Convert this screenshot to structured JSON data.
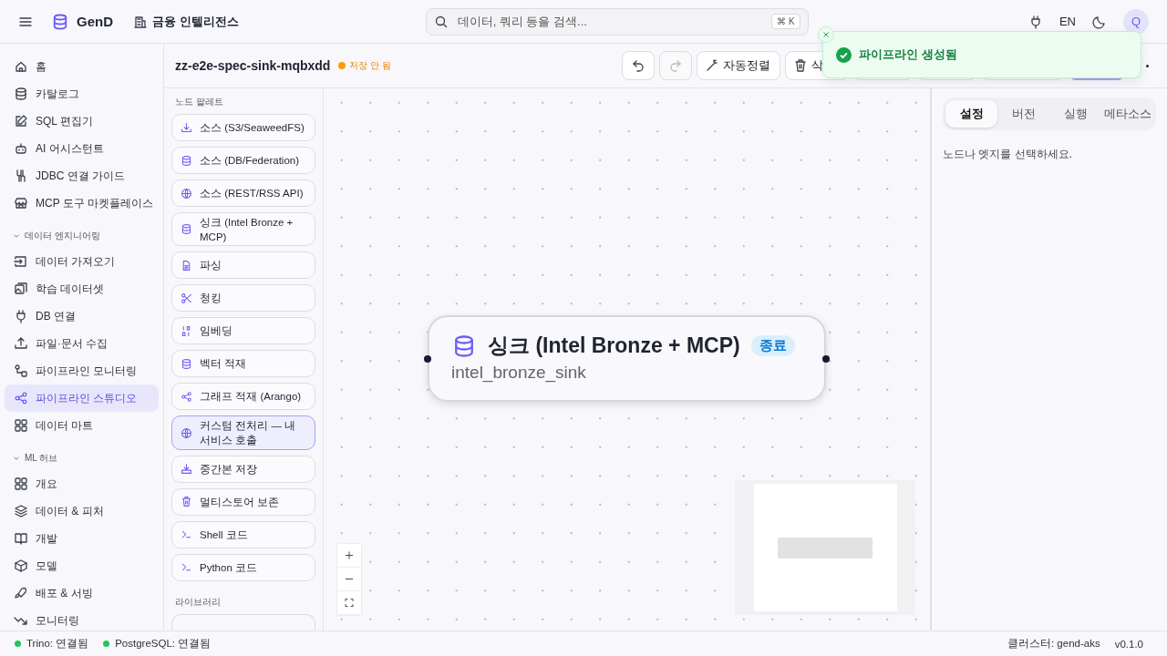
{
  "topbar": {
    "app_name": "GenD",
    "workspace": "금융 인텔리전스",
    "search": {
      "placeholder": "데이터, 쿼리 등을 검색...",
      "shortcut": "⌘ K"
    },
    "language": "EN",
    "avatar": "Q"
  },
  "sidebar": {
    "groups": [
      {
        "items": [
          {
            "label": "홈",
            "selected": false
          },
          {
            "label": "카탈로그",
            "selected": false
          },
          {
            "label": "SQL 편집기",
            "selected": false
          },
          {
            "label": "AI 어시스턴트",
            "selected": false
          },
          {
            "label": "JDBC 연결 가이드",
            "selected": false
          },
          {
            "label": "MCP 도구 마켓플레이스",
            "selected": false
          }
        ]
      },
      {
        "heading": "데이터 엔지니어링",
        "expanded": true,
        "items": [
          {
            "label": "데이터 가져오기",
            "selected": false
          },
          {
            "label": "학습 데이터셋",
            "selected": false
          },
          {
            "label": "DB 연결",
            "selected": false
          },
          {
            "label": "파일·문서 수집",
            "selected": false
          },
          {
            "label": "파이프라인 모니터링",
            "selected": false
          },
          {
            "label": "파이프라인 스튜디오",
            "selected": true
          },
          {
            "label": "데이터 마트",
            "selected": false
          }
        ]
      },
      {
        "heading": "ML 허브",
        "expanded": true,
        "items": [
          {
            "label": "개요",
            "selected": false
          },
          {
            "label": "데이터 & 피처",
            "selected": false
          },
          {
            "label": "개발",
            "selected": false
          },
          {
            "label": "모델",
            "selected": false
          },
          {
            "label": "배포 & 서빙",
            "selected": false
          },
          {
            "label": "모니터링",
            "selected": false
          }
        ]
      }
    ]
  },
  "editor": {
    "pipeline_name": "zz-e2e-spec-sink-mqbxdd",
    "save_status": "저장 안 됨",
    "toolbar": [
      {
        "kind": "undo",
        "disabled": false
      },
      {
        "kind": "redo",
        "disabled": true
      },
      {
        "kind": "text",
        "label": "자동정렬"
      },
      {
        "kind": "text",
        "label": "삭"
      },
      {
        "kind": "blank"
      },
      {
        "kind": "blank"
      },
      {
        "kind": "blank"
      },
      {
        "kind": "primary"
      }
    ]
  },
  "palette": {
    "title": "노드 팔레트",
    "items": [
      {
        "label": "소스 (S3/SeaweedFS)",
        "selected": false
      },
      {
        "label": "소스 (DB/Federation)",
        "selected": false
      },
      {
        "label": "소스 (REST/RSS API)",
        "selected": false
      },
      {
        "label": "싱크 (Intel Bronze + MCP)",
        "selected": false
      },
      {
        "label": "파싱",
        "selected": false
      },
      {
        "label": "청킹",
        "selected": false
      },
      {
        "label": "임베딩",
        "selected": false
      },
      {
        "label": "벡터 적재",
        "selected": false
      },
      {
        "label": "그래프 적재 (Arango)",
        "selected": false
      },
      {
        "label": "커스텀 전처리 — 내 서비스 호출",
        "selected": true
      },
      {
        "label": "중간본 저장",
        "selected": false
      },
      {
        "label": "멀티스토어 보존",
        "selected": false
      },
      {
        "label": "Shell 코드",
        "selected": false
      },
      {
        "label": "Python 코드",
        "selected": false
      }
    ],
    "library_title": "라이브러리"
  },
  "canvas": {
    "node": {
      "title": "싱크 (Intel Bronze + MCP)",
      "badge": "종료",
      "subtitle": "intel_bronze_sink"
    }
  },
  "panel": {
    "tabs": [
      {
        "label": "설정",
        "selected": true
      },
      {
        "label": "버전",
        "selected": false
      },
      {
        "label": "실행",
        "selected": false
      },
      {
        "label": "메타소스",
        "selected": false
      }
    ],
    "message": "노드나 엣지를 선택하세요."
  },
  "toast": {
    "message": "파이프라인 생성됨"
  },
  "status_bar": {
    "connections": [
      {
        "label": "Trino: 연결됨",
        "color": "#22c55e"
      },
      {
        "label": "PostgreSQL: 연결됨",
        "color": "#22c55e"
      }
    ],
    "cluster": "클러스터: gend-aks",
    "version": "v0.1.0"
  }
}
